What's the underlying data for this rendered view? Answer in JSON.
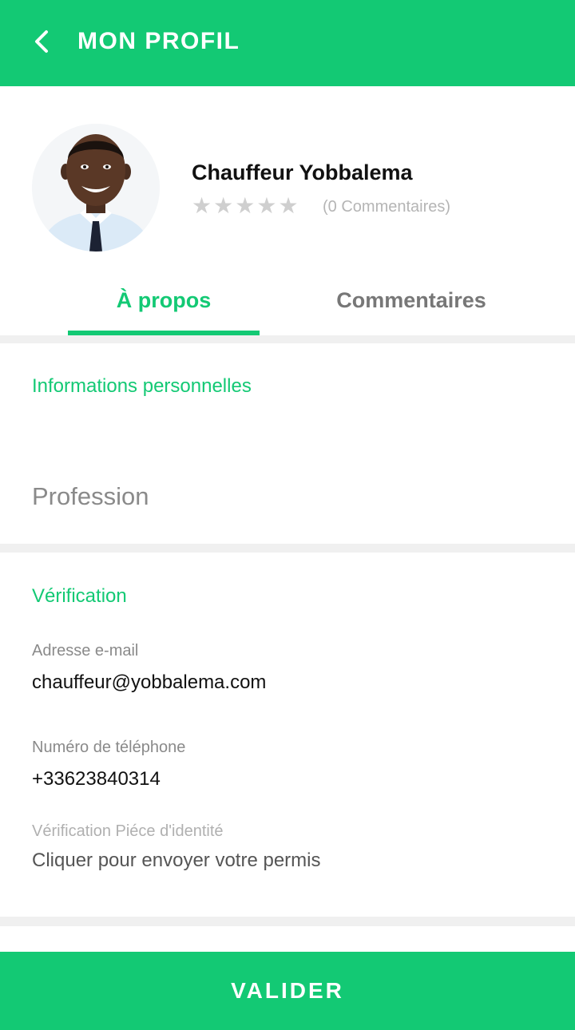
{
  "header": {
    "title": "MON PROFIL"
  },
  "profile": {
    "name": "Chauffeur Yobbalema",
    "rating": 0,
    "rating_max": 5,
    "stars": [
      "★",
      "★",
      "★",
      "★",
      "★"
    ],
    "review_count_label": "(0 Commentaires)"
  },
  "tabs": [
    {
      "label": "À propos",
      "active": true
    },
    {
      "label": "Commentaires",
      "active": false
    }
  ],
  "personal": {
    "title": "Informations personnelles",
    "profession_placeholder": "Profession"
  },
  "verification": {
    "title": "Vérification",
    "email_label": "Adresse e-mail",
    "email_value": "chauffeur@yobbalema.com",
    "phone_label": "Numéro de téléphone",
    "phone_value": "+33623840314",
    "id_label": "Vérification Piéce d'identité",
    "id_action": "Cliquer pour envoyer votre permis"
  },
  "submit": {
    "label": "VALIDER"
  },
  "colors": {
    "accent": "#13c974",
    "divider": "#f0f0f0",
    "muted": "#8a8a8a",
    "star": "#cfcfcf"
  }
}
